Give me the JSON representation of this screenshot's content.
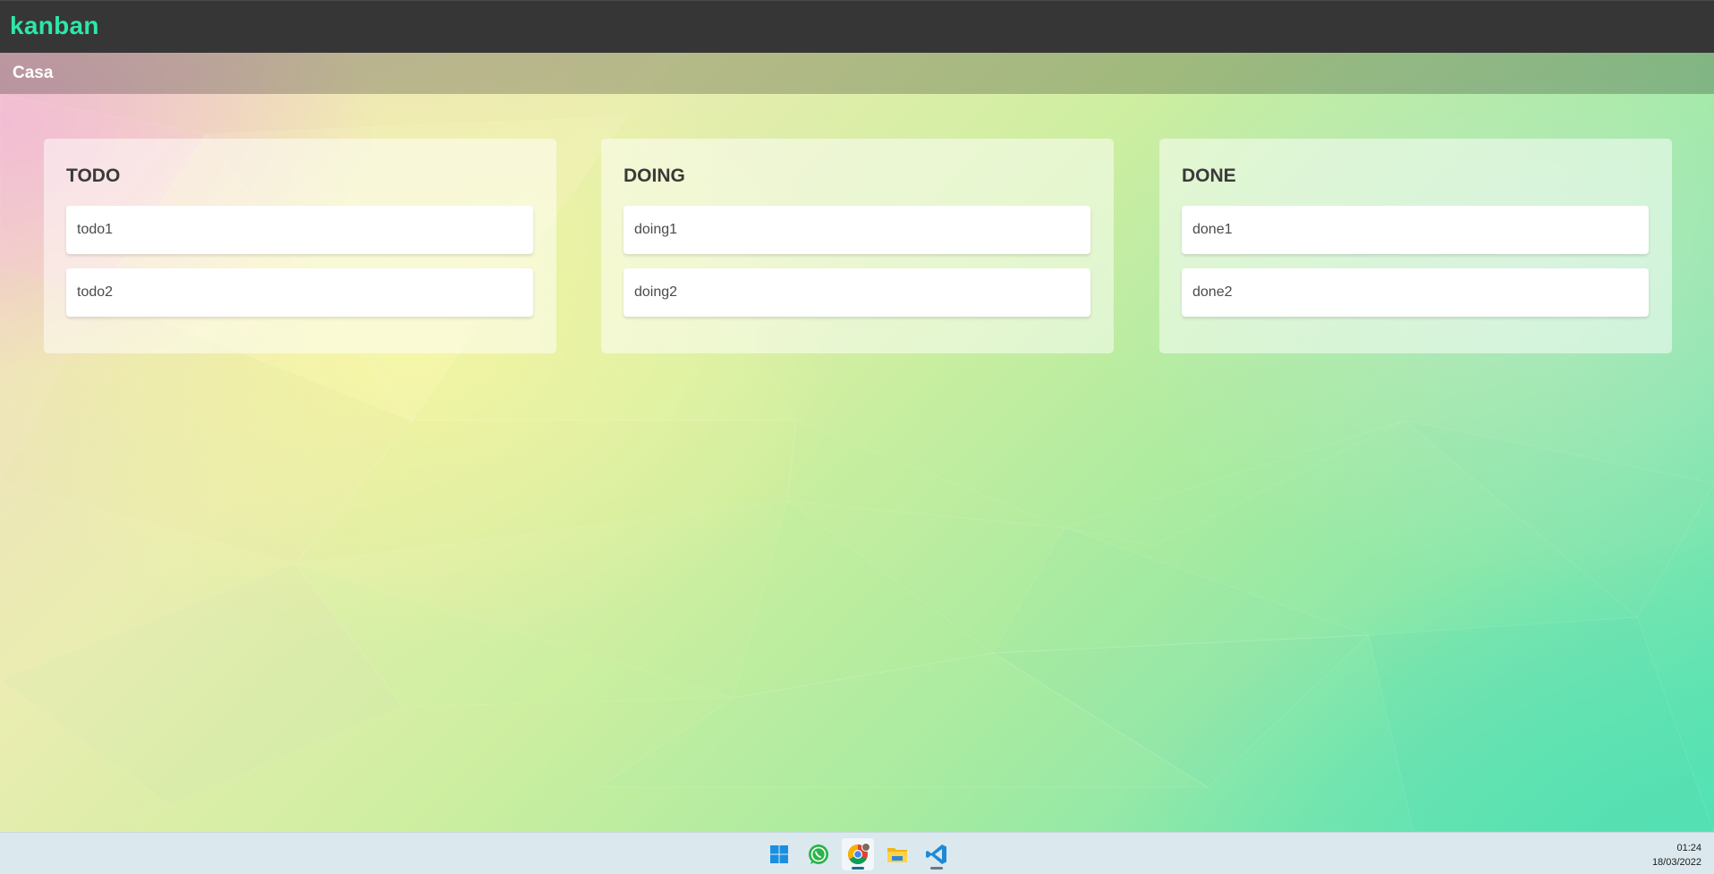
{
  "app": {
    "brand": "kanban",
    "brand_color": "#2ee6a9"
  },
  "board": {
    "title": "Casa"
  },
  "lists": [
    {
      "title": "TODO",
      "cards": [
        "todo1",
        "todo2"
      ]
    },
    {
      "title": "DOING",
      "cards": [
        "doing1",
        "doing2"
      ]
    },
    {
      "title": "DONE",
      "cards": [
        "done1",
        "done2"
      ]
    }
  ],
  "taskbar": {
    "icons": [
      "windows-start-icon",
      "whatsapp-icon",
      "chrome-icon",
      "file-explorer-icon",
      "vscode-icon"
    ],
    "time": "01:24",
    "date": "18/03/2022"
  }
}
